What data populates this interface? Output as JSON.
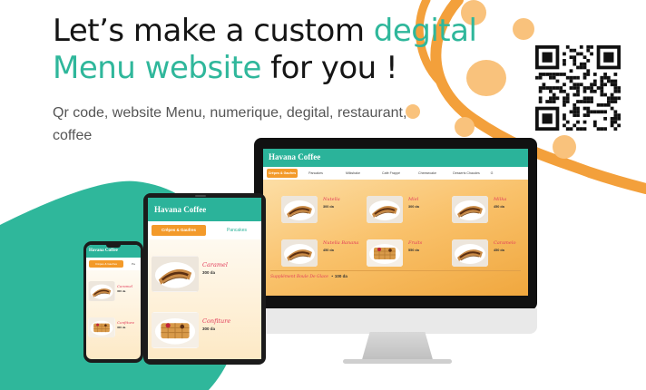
{
  "headline": {
    "line1_dark": "Let’s make a custom ",
    "line1_accent": "degital",
    "line2_accent": "Menu website",
    "line2_dark": " for you !"
  },
  "subtitle": "Qr code, website Menu, numerique, degital, restaurant, coffee",
  "colors": {
    "accent": "#2fb79b",
    "orange": "#f39a2a",
    "item_name": "#e23b5a"
  },
  "desktop": {
    "app_title": "Havana Coffee",
    "tabs": [
      "Crêpes & Gaufres",
      "Pancakes",
      "Milkshake",
      "Café Frappé",
      "Cheesecake",
      "Desserts Chaudes",
      "G"
    ],
    "items": [
      {
        "name": "Nutella",
        "price": "300 da"
      },
      {
        "name": "Miel",
        "price": "300 da"
      },
      {
        "name": "Milka",
        "price": "450 da"
      },
      {
        "name": "Nutella Banana",
        "price": "450 da"
      },
      {
        "name": "Fruits",
        "price": "550 da"
      },
      {
        "name": "Caramelo",
        "price": "450 da"
      }
    ],
    "supplement": {
      "label": "Supplément Boule De Glace",
      "price": "100 da"
    }
  },
  "tablet": {
    "app_title": "Havana Coffee",
    "tabs": [
      "Crêpes & Gaufres",
      "Pancakes"
    ],
    "items": [
      {
        "name": "Caramel",
        "price": "300 da"
      },
      {
        "name": "Confiture",
        "price": "300 da"
      }
    ]
  },
  "phone": {
    "app_title": "Havana Coffee",
    "tabs": [
      "Crêpes & Gaufres",
      "Pa"
    ],
    "items": [
      {
        "name": "Caramel",
        "price": "300 da"
      },
      {
        "name": "Confiture",
        "price": "300 da"
      }
    ]
  },
  "icons": [
    "qr-code-icon",
    "crepe-food-icon",
    "waffle-food-icon"
  ]
}
